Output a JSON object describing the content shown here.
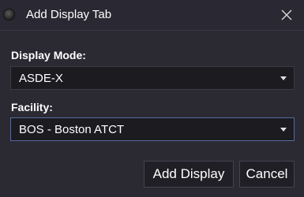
{
  "window": {
    "title": "Add Display Tab",
    "icon": "app-orb-icon",
    "close_icon": "close-icon"
  },
  "form": {
    "display_mode": {
      "label": "Display Mode:",
      "value": "ASDE-X"
    },
    "facility": {
      "label": "Facility:",
      "value": "BOS - Boston ATCT"
    }
  },
  "buttons": {
    "add": "Add Display",
    "cancel": "Cancel"
  },
  "colors": {
    "background": "#2b2a33",
    "field_background": "#1b1b20",
    "field_border": "#3c3b46",
    "focus_border": "#5a6a9a",
    "text": "#ffffff"
  }
}
